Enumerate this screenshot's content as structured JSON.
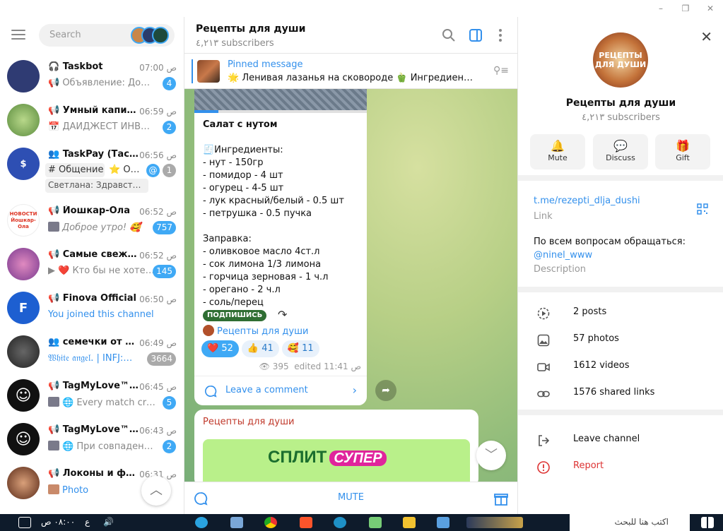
{
  "app": {
    "window_controls": {
      "minimize": "–",
      "maximize": "❐",
      "close": "✕"
    }
  },
  "sidebar": {
    "search_placeholder": "Search",
    "chats": [
      {
        "name": "Taskbot",
        "prefix": "🎧",
        "time": "07:00 ص",
        "preview": "📢 Объявление: Добр…",
        "badge": "4",
        "avatar_color": "#2f3b73",
        "avatar_text": ""
      },
      {
        "name": "Умный капитал",
        "prefix": "📢",
        "time": "06:59 ص",
        "preview": "📅 ДАЙДЖЕСТ ИНВЕСТ…",
        "badge": "2",
        "avatar_color": "#5b8c3e",
        "avatar_text": ""
      },
      {
        "name": "TaskPay (Таскп…",
        "prefix": "👥",
        "time": "06:56 ص",
        "topic": "# Общение",
        "topic2": "⭐ О…",
        "preview": "Светлана: Здравст…",
        "mention": "@",
        "badge": "1",
        "avatar_color": "#2e4fb3",
        "avatar_text": "$"
      },
      {
        "name": "Йошкар-Ола",
        "prefix": "📢",
        "time": "06:52 ص",
        "preview": "Доброе утро! 🥰",
        "badge": "757",
        "avatar_color": "#ffffff",
        "avatar_text": "НОВОСТИ Йошкар-Ола"
      },
      {
        "name": "Самые свежие …",
        "prefix": "📢",
        "time": "06:52 ص",
        "preview": "▶ ❤️ Кто бы не хоте…",
        "badge": "145",
        "avatar_color": "#7a3a90",
        "avatar_text": ""
      },
      {
        "name": "Finova Official",
        "prefix": "📢",
        "time": "06:50 ص",
        "preview": "You joined this channel",
        "badge": "",
        "avatar_color": "#1d5fd1",
        "avatar_text": "F"
      },
      {
        "name": "семечки от ма…",
        "prefix": "👥",
        "time": "06:49 ص",
        "preview": "𝔚𝔥𝔦𝔱𝔢 𝔞𝔫𝔤𝔢𝔩. | INFJ:…",
        "badge": "3664",
        "avatar_color": "#3a3a3a",
        "avatar_text": ""
      },
      {
        "name": "TagMyLove™ N…",
        "prefix": "📢",
        "time": "06:45 ص",
        "preview": "🌐 Every match crea…",
        "badge": "5",
        "avatar_color": "#111111",
        "avatar_text": "☺"
      },
      {
        "name": "TagMyLove™ N…",
        "prefix": "📢",
        "time": "06:43 ص",
        "preview": "🌐 При совпадении …",
        "badge": "2",
        "avatar_color": "#111111",
        "avatar_text": "☺"
      },
      {
        "name": "Локоны и фан…",
        "prefix": "📢",
        "time": "06:31 ص",
        "preview": "Photo",
        "badge": "",
        "avatar_color": "#8a4a30",
        "avatar_text": ""
      }
    ]
  },
  "chat": {
    "title": "Рецепты для души",
    "subscribers": "٤,٢١٣ subscribers",
    "pinned_label": "Pinned message",
    "pinned_text": "🌟 Ленивая лазанья на сковороде 🫑 Ингредиенты: …",
    "message": {
      "title": "Салат с нутом",
      "body": "🧾Ингредиенты:\n- нут - 150гр\n- помидор - 4 шт\n- огурец - 4-5 шт\n- лук красный/белый - 0.5 шт\n- петрушка - 0.5 пучка\n\nЗаправка:\n- оливковое масло  4ст.л\n- сок лимона 1/3 лимона\n- горчица зерновая - 1 ч.л\n- орегано - 2 ч.л\n- соль/перец",
      "subscribe_label": "ПОДПИШИСЬ",
      "channel_link": "Рецепты для души",
      "reactions": [
        {
          "emoji": "❤️",
          "count": "52"
        },
        {
          "emoji": "👍",
          "count": "41"
        },
        {
          "emoji": "🥰",
          "count": "11"
        }
      ],
      "views": "👁 395",
      "edited": "edited 11:41 ص",
      "comment_label": "Leave a comment"
    },
    "message2": {
      "author": "Рецепты для души",
      "banner_brand": "СПЛИТ",
      "banner_tag": "СУПЕР"
    },
    "mute_label": "MUTE"
  },
  "info": {
    "title": "Рецепты для души",
    "subscribers": "٤,٢١٣ subscribers",
    "avatar_text": "РЕЦЕПТЫ ДЛЯ ДУШИ",
    "actions": [
      {
        "icon": "bell-icon",
        "glyph": "🔔",
        "label": "Mute"
      },
      {
        "icon": "discuss-icon",
        "glyph": "💬",
        "label": "Discuss"
      },
      {
        "icon": "gift-icon",
        "glyph": "🎁",
        "label": "Gift"
      }
    ],
    "link": "t.me/rezepti_dlja_dushi",
    "link_label": "Link",
    "description_text": "По всем вопросам обращаться:",
    "description_mention": "@ninel_www",
    "description_label": "Description",
    "stats": [
      {
        "icon": "posts-icon",
        "label": "2 posts"
      },
      {
        "icon": "photos-icon",
        "label": "57 photos"
      },
      {
        "icon": "videos-icon",
        "label": "1612 videos"
      },
      {
        "icon": "links-icon",
        "label": "1576 shared links"
      }
    ],
    "leave_label": "Leave channel",
    "report_label": "Report"
  },
  "taskbar": {
    "time": "٠٨:٠٠ ص",
    "lang": "ع",
    "search_placeholder": "اكتب هنا للبحث"
  }
}
